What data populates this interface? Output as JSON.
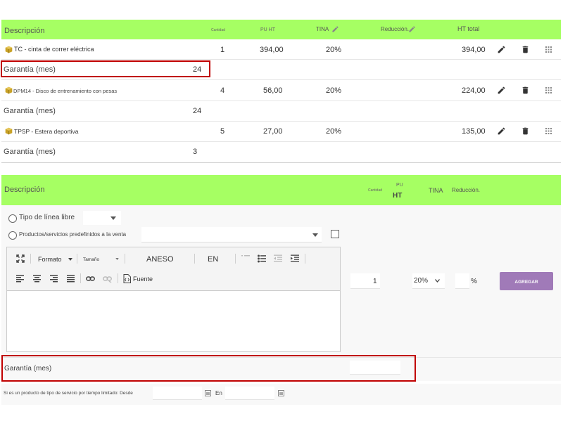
{
  "top_table": {
    "headers": {
      "description": "Descripción",
      "qty": "Cantidad",
      "pu_ht": "PU HT",
      "tina": "TINA",
      "reduction": "Reducción.",
      "ht_total": "HT total"
    },
    "rows": [
      {
        "product": "TC - cinta de correr eléctrica",
        "qty": "1",
        "pu": "394,00",
        "tina": "20%",
        "total": "394,00",
        "attr_label": "Garantía (mes)",
        "attr_value": "24"
      },
      {
        "product": "DPM14 - Disco de entrenamiento con pesas",
        "qty": "4",
        "pu": "56,00",
        "tina": "20%",
        "total": "224,00",
        "attr_label": "Garantía (mes)",
        "attr_value": "24"
      },
      {
        "product": "TPSP - Estera deportiva",
        "qty": "5",
        "pu": "27,00",
        "tina": "20%",
        "total": "135,00",
        "attr_label": "Garantía (mes)",
        "attr_value": "3"
      }
    ]
  },
  "add_form": {
    "headers": {
      "description": "Descripción",
      "qty": "Cantidad",
      "pu": "PU",
      "ht": "HT",
      "tina": "TINA",
      "reduction": "Reducción."
    },
    "free_line_label": "Tipo de línea libre",
    "predefined_label": "Productos/servicios predefinidos a la venta",
    "editor": {
      "format_label": "Formato",
      "size_label": "Tamaño",
      "aneso_label": "ANESO",
      "en_label": "EN",
      "source_label": "Fuente"
    },
    "qty_value": "1",
    "vat_value": "20%",
    "percent_label": "%",
    "add_button": "AGREGAR",
    "warranty_label": "Garantía (mes)",
    "service_period_label": "Si es un producto de tipo de servicio por tiempo limitado: Desde",
    "to_label": "En"
  },
  "colors": {
    "header_green": "#a6ff63",
    "highlight_red": "#c00000",
    "add_button": "#a07ab8"
  }
}
